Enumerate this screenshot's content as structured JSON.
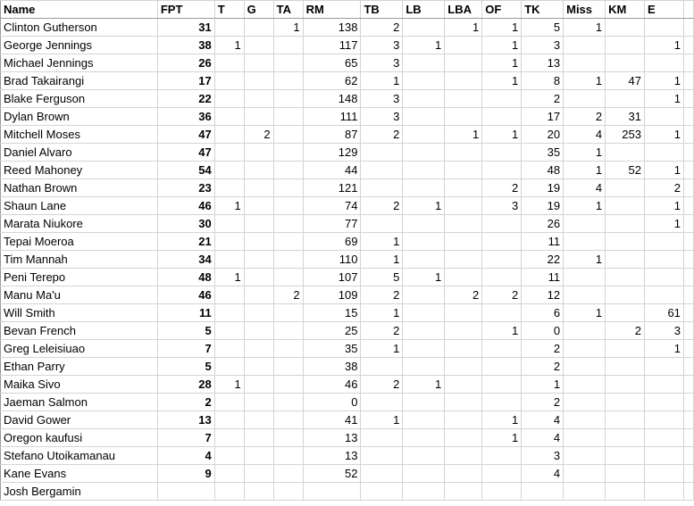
{
  "sheet": {
    "columns": [
      "Name",
      "FPT",
      "T",
      "G",
      "TA",
      "RM",
      "TB",
      "LB",
      "LBA",
      "OF",
      "TK",
      "Miss",
      "KM",
      "E"
    ],
    "rows": [
      [
        "Clinton Gutherson",
        "31",
        "",
        "",
        "1",
        "138",
        "2",
        "",
        "1",
        "1",
        "5",
        "1",
        "",
        ""
      ],
      [
        "George Jennings",
        "38",
        "1",
        "",
        "",
        "117",
        "3",
        "1",
        "",
        "1",
        "3",
        "",
        "",
        "1"
      ],
      [
        "Michael Jennings",
        "26",
        "",
        "",
        "",
        "65",
        "3",
        "",
        "",
        "1",
        "13",
        "",
        "",
        ""
      ],
      [
        "Brad Takairangi",
        "17",
        "",
        "",
        "",
        "62",
        "1",
        "",
        "",
        "1",
        "8",
        "1",
        "47",
        "1"
      ],
      [
        "Blake Ferguson",
        "22",
        "",
        "",
        "",
        "148",
        "3",
        "",
        "",
        "",
        "2",
        "",
        "",
        "1"
      ],
      [
        "Dylan Brown",
        "36",
        "",
        "",
        "",
        "111",
        "3",
        "",
        "",
        "",
        "17",
        "2",
        "31",
        ""
      ],
      [
        "Mitchell Moses",
        "47",
        "",
        "2",
        "",
        "87",
        "2",
        "",
        "1",
        "1",
        "20",
        "4",
        "253",
        "1"
      ],
      [
        "Daniel Alvaro",
        "47",
        "",
        "",
        "",
        "129",
        "",
        "",
        "",
        "",
        "35",
        "1",
        "",
        ""
      ],
      [
        "Reed Mahoney",
        "54",
        "",
        "",
        "",
        "44",
        "",
        "",
        "",
        "",
        "48",
        "1",
        "52",
        "1"
      ],
      [
        "Nathan Brown",
        "23",
        "",
        "",
        "",
        "121",
        "",
        "",
        "",
        "2",
        "19",
        "4",
        "",
        "2"
      ],
      [
        "Shaun Lane",
        "46",
        "1",
        "",
        "",
        "74",
        "2",
        "1",
        "",
        "3",
        "19",
        "1",
        "",
        "1"
      ],
      [
        "Marata Niukore",
        "30",
        "",
        "",
        "",
        "77",
        "",
        "",
        "",
        "",
        "26",
        "",
        "",
        "1"
      ],
      [
        "Tepai Moeroa",
        "21",
        "",
        "",
        "",
        "69",
        "1",
        "",
        "",
        "",
        "11",
        "",
        "",
        ""
      ],
      [
        "Tim Mannah",
        "34",
        "",
        "",
        "",
        "110",
        "1",
        "",
        "",
        "",
        "22",
        "1",
        "",
        ""
      ],
      [
        "Peni Terepo",
        "48",
        "1",
        "",
        "",
        "107",
        "5",
        "1",
        "",
        "",
        "11",
        "",
        "",
        ""
      ],
      [
        "Manu Ma'u",
        "46",
        "",
        "",
        "2",
        "109",
        "2",
        "",
        "2",
        "2",
        "12",
        "",
        "",
        ""
      ],
      [
        "Will Smith",
        "11",
        "",
        "",
        "",
        "15",
        "1",
        "",
        "",
        "",
        "6",
        "1",
        "",
        "61"
      ],
      [
        "Bevan French",
        "5",
        "",
        "",
        "",
        "25",
        "2",
        "",
        "",
        "1",
        "0",
        "",
        "2",
        "3"
      ],
      [
        "Greg Leleisiuao",
        "7",
        "",
        "",
        "",
        "35",
        "1",
        "",
        "",
        "",
        "2",
        "",
        "",
        "1"
      ],
      [
        "Ethan Parry",
        "5",
        "",
        "",
        "",
        "38",
        "",
        "",
        "",
        "",
        "2",
        "",
        "",
        ""
      ],
      [
        "Maika Sivo",
        "28",
        "1",
        "",
        "",
        "46",
        "2",
        "1",
        "",
        "",
        "1",
        "",
        "",
        ""
      ],
      [
        "Jaeman Salmon",
        "2",
        "",
        "",
        "",
        "0",
        "",
        "",
        "",
        "",
        "2",
        "",
        "",
        ""
      ],
      [
        "David Gower",
        "13",
        "",
        "",
        "",
        "41",
        "1",
        "",
        "",
        "1",
        "4",
        "",
        "",
        ""
      ],
      [
        "Oregon kaufusi",
        "7",
        "",
        "",
        "",
        "13",
        "",
        "",
        "",
        "1",
        "4",
        "",
        "",
        ""
      ],
      [
        "Stefano Utoikamanau",
        "4",
        "",
        "",
        "",
        "13",
        "",
        "",
        "",
        "",
        "3",
        "",
        "",
        ""
      ],
      [
        "Kane Evans",
        "9",
        "",
        "",
        "",
        "52",
        "",
        "",
        "",
        "",
        "4",
        "",
        "",
        ""
      ],
      [
        "Josh Bergamin",
        "",
        "",
        "",
        "",
        "",
        "",
        "",
        "",
        "",
        "",
        "",
        "",
        ""
      ]
    ]
  }
}
